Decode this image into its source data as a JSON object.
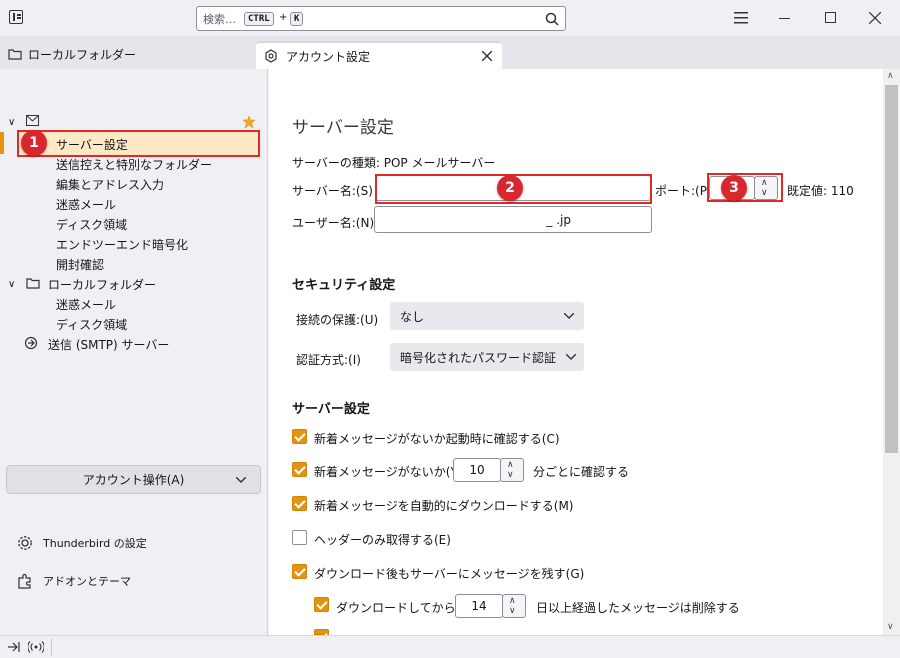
{
  "titlebar": {
    "search_placeholder": "検索…",
    "shortcut_ctrl": "CTRL",
    "shortcut_plus": "+",
    "shortcut_k": "K"
  },
  "tabs": [
    {
      "label": "ローカルフォルダー"
    },
    {
      "label": "アカウント設定"
    }
  ],
  "sidebar": {
    "tree": [
      {
        "label": "サーバー設定"
      },
      {
        "label": "送信控えと特別なフォルダー"
      },
      {
        "label": "編集とアドレス入力"
      },
      {
        "label": "迷惑メール"
      },
      {
        "label": "ディスク領域"
      },
      {
        "label": "エンドツーエンド暗号化"
      },
      {
        "label": "開封確認"
      },
      {
        "label": "ローカルフォルダー"
      },
      {
        "label": "迷惑メール"
      },
      {
        "label": "ディスク領域"
      },
      {
        "label": "送信 (SMTP) サーバー"
      }
    ],
    "account_actions": "アカウント操作(A)",
    "settings": "Thunderbird の設定",
    "addons": "アドオンとテーマ"
  },
  "main": {
    "title": "サーバー設定",
    "server_type": "サーバーの種類: POP メールサーバー",
    "server_name_label": "サーバー名:(S)",
    "server_name_value": "",
    "port_label": "ポート:(P)",
    "port_value": "",
    "default_port": "既定値: 110",
    "username_label": "ユーザー名:(N)",
    "username_value": "_ .jp",
    "security_heading": "セキュリティ設定",
    "conn_label": "接続の保護:(U)",
    "conn_value": "なし",
    "auth_label": "認証方式:(I)",
    "auth_value": "暗号化されたパスワード認証",
    "server_heading": "サーバー設定",
    "options": [
      {
        "label": "新着メッセージがないか起動時に確認する(C)",
        "checked": true
      },
      {
        "label": "新着メッセージがないか(Y)",
        "checked": true,
        "spin_value": "10",
        "suffix": "分ごとに確認する"
      },
      {
        "label": "新着メッセージを自動的にダウンロードする(M)",
        "checked": true
      },
      {
        "label": "ヘッダーのみ取得する(E)",
        "checked": false
      },
      {
        "label": "ダウンロード後もサーバーにメッセージを残す(G)",
        "checked": true
      },
      {
        "label": "ダウンロードしてから(O)",
        "checked": true,
        "spin_value": "14",
        "suffix": "日以上経過したメッセージは削除する"
      }
    ]
  },
  "annotations": {
    "badge1": "1",
    "badge2": "2",
    "badge3": "3"
  },
  "colors": {
    "accent_orange": "#e59412",
    "annotation_red": "#e02a2a"
  }
}
